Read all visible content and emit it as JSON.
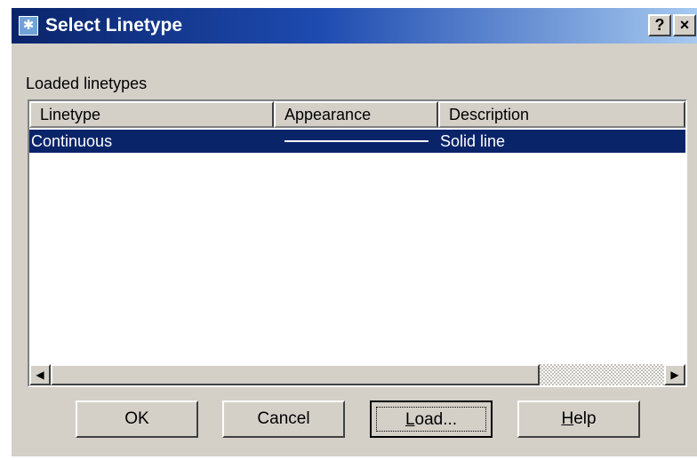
{
  "window": {
    "title": "Select Linetype",
    "help_button": "?",
    "close_button": "×"
  },
  "list": {
    "group_label": "Loaded linetypes",
    "columns": [
      "Linetype",
      "Appearance",
      "Description"
    ],
    "rows": [
      {
        "linetype": "Continuous",
        "appearance": "solid-line",
        "description": "Solid line",
        "selected": true
      }
    ]
  },
  "buttons": {
    "ok": "OK",
    "cancel": "Cancel",
    "load_mnemonic": "L",
    "load_rest": "oad...",
    "help_mnemonic": "H",
    "help_rest": "elp"
  },
  "colors": {
    "titlebar": "#0a246a",
    "selection": "#0a246a",
    "dialog_face": "#d4d0c8"
  }
}
